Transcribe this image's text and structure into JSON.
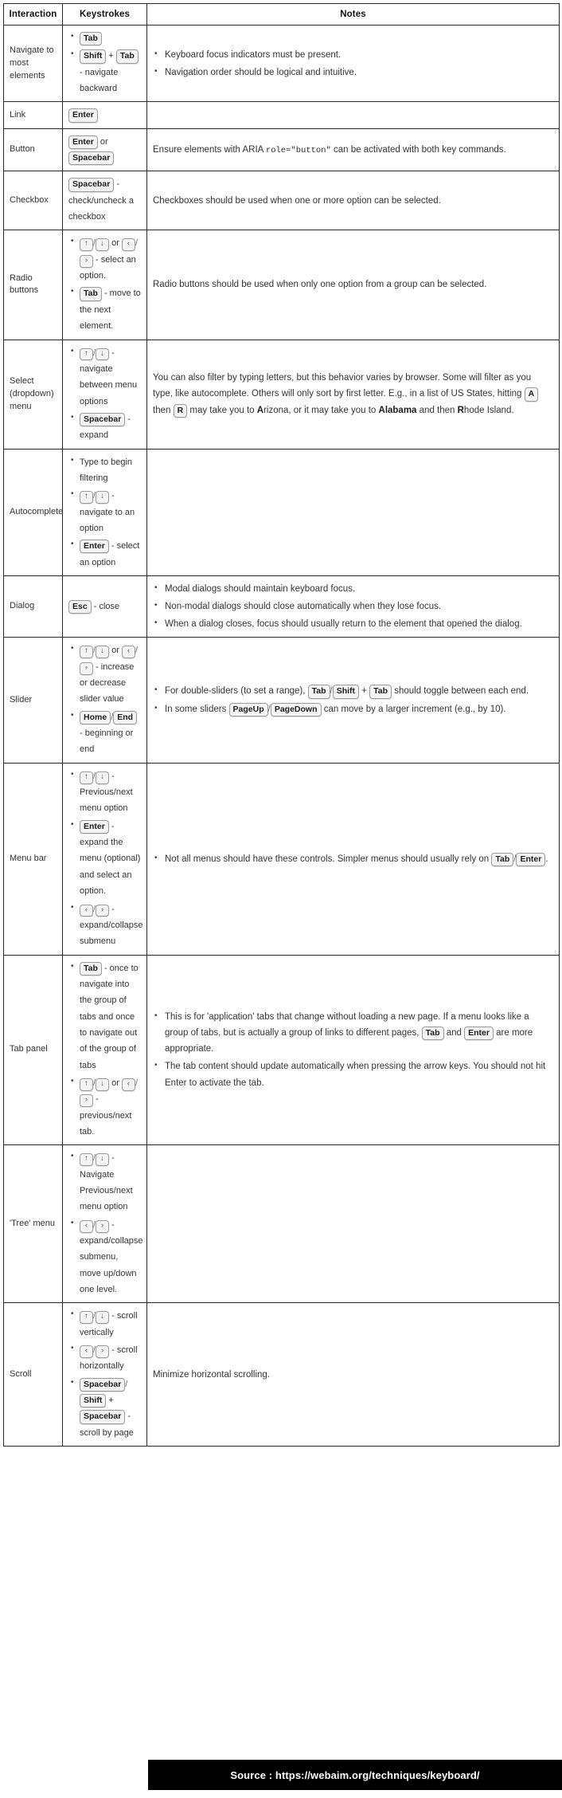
{
  "table": {
    "headers": [
      "Interaction",
      "Keystrokes",
      "Notes"
    ],
    "rows": [
      {
        "interaction": "Navigate to most elements",
        "keys": [
          {
            "parts": [
              {
                "t": "key",
                "v": "Tab"
              }
            ]
          },
          {
            "parts": [
              {
                "t": "key",
                "v": "Shift"
              },
              {
                "t": "text",
                "v": " + "
              },
              {
                "t": "key",
                "v": "Tab"
              },
              {
                "t": "text",
                "v": " - navigate backward"
              }
            ]
          }
        ],
        "notes": [
          {
            "parts": [
              {
                "t": "text",
                "v": "Keyboard focus indicators must be present."
              }
            ]
          },
          {
            "parts": [
              {
                "t": "text",
                "v": "Navigation order should be logical and intuitive."
              }
            ]
          }
        ]
      },
      {
        "interaction": "Link",
        "keys_plain": {
          "parts": [
            {
              "t": "key",
              "v": "Enter"
            }
          ]
        },
        "notes_plain": {
          "parts": []
        }
      },
      {
        "interaction": "Button",
        "keys_plain": {
          "parts": [
            {
              "t": "key",
              "v": "Enter"
            },
            {
              "t": "text",
              "v": " or "
            },
            {
              "t": "key",
              "v": "Spacebar"
            }
          ]
        },
        "notes_plain": {
          "parts": [
            {
              "t": "text",
              "v": "Ensure elements with ARIA "
            },
            {
              "t": "code",
              "v": "role=\"button\""
            },
            {
              "t": "text",
              "v": " can be activated with both key commands."
            }
          ]
        }
      },
      {
        "interaction": "Checkbox",
        "keys_plain": {
          "parts": [
            {
              "t": "key",
              "v": "Spacebar"
            },
            {
              "t": "text",
              "v": " - check/uncheck a checkbox"
            }
          ]
        },
        "notes_plain": {
          "parts": [
            {
              "t": "text",
              "v": "Checkboxes should be used when one or more option can be selected."
            }
          ]
        }
      },
      {
        "interaction": "Radio buttons",
        "keys": [
          {
            "parts": [
              {
                "t": "arrow",
                "v": "↑"
              },
              {
                "t": "slash"
              },
              {
                "t": "arrow",
                "v": "↓"
              },
              {
                "t": "text",
                "v": " or "
              },
              {
                "t": "arrow",
                "v": "‹"
              },
              {
                "t": "slash"
              },
              {
                "t": "arrow",
                "v": "›"
              },
              {
                "t": "text",
                "v": " - select an option."
              }
            ]
          },
          {
            "parts": [
              {
                "t": "key",
                "v": "Tab"
              },
              {
                "t": "text",
                "v": " - move to the next element."
              }
            ]
          }
        ],
        "notes_plain": {
          "parts": [
            {
              "t": "text",
              "v": "Radio buttons should be used when only one option from a group can be selected."
            }
          ]
        }
      },
      {
        "interaction": "Select (dropdown) menu",
        "keys": [
          {
            "parts": [
              {
                "t": "arrow",
                "v": "↑"
              },
              {
                "t": "slash"
              },
              {
                "t": "arrow",
                "v": "↓"
              },
              {
                "t": "text",
                "v": " - navigate between menu options"
              }
            ]
          },
          {
            "parts": [
              {
                "t": "key",
                "v": "Spacebar"
              },
              {
                "t": "text",
                "v": " - expand"
              }
            ]
          }
        ],
        "notes_plain": {
          "parts": [
            {
              "t": "text",
              "v": "You can also filter by typing letters, but this behavior varies by browser. Some will filter as you type, like autocomplete. Others will only sort by first letter. E.g., in a list of US States, hitting "
            },
            {
              "t": "key",
              "v": "A"
            },
            {
              "t": "text",
              "v": " then "
            },
            {
              "t": "key",
              "v": "R"
            },
            {
              "t": "text",
              "v": " may take you to "
            },
            {
              "t": "bold",
              "v": "A"
            },
            {
              "t": "text",
              "v": "rizona, or it may take you to "
            },
            {
              "t": "bold",
              "v": "Alabama"
            },
            {
              "t": "text",
              "v": " and then "
            },
            {
              "t": "bold",
              "v": "R"
            },
            {
              "t": "text",
              "v": "hode Island."
            }
          ]
        }
      },
      {
        "interaction": "Autocomplete",
        "keys": [
          {
            "parts": [
              {
                "t": "text",
                "v": "Type to begin filtering"
              }
            ]
          },
          {
            "parts": [
              {
                "t": "arrow",
                "v": "↑"
              },
              {
                "t": "slash"
              },
              {
                "t": "arrow",
                "v": "↓"
              },
              {
                "t": "text",
                "v": " - navigate to an option"
              }
            ]
          },
          {
            "parts": [
              {
                "t": "key",
                "v": "Enter"
              },
              {
                "t": "text",
                "v": " - select an option"
              }
            ]
          }
        ],
        "notes_plain": {
          "parts": []
        }
      },
      {
        "interaction": "Dialog",
        "keys_plain": {
          "parts": [
            {
              "t": "key",
              "v": "Esc"
            },
            {
              "t": "text",
              "v": " - close"
            }
          ]
        },
        "notes": [
          {
            "parts": [
              {
                "t": "text",
                "v": "Modal dialogs should maintain keyboard focus."
              }
            ]
          },
          {
            "parts": [
              {
                "t": "text",
                "v": "Non-modal dialogs should close automatically when they lose focus."
              }
            ]
          },
          {
            "parts": [
              {
                "t": "text",
                "v": "When a dialog closes, focus should usually return to the element that opened the dialog."
              }
            ]
          }
        ]
      },
      {
        "interaction": "Slider",
        "keys": [
          {
            "parts": [
              {
                "t": "arrow",
                "v": "↑"
              },
              {
                "t": "slash"
              },
              {
                "t": "arrow",
                "v": "↓"
              },
              {
                "t": "text",
                "v": " or "
              },
              {
                "t": "arrow",
                "v": "‹"
              },
              {
                "t": "slash"
              },
              {
                "t": "arrow",
                "v": "›"
              },
              {
                "t": "text",
                "v": " - increase or decrease slider value"
              }
            ]
          },
          {
            "parts": [
              {
                "t": "key",
                "v": "Home"
              },
              {
                "t": "slashtxt"
              },
              {
                "t": "key",
                "v": "End"
              },
              {
                "t": "text",
                "v": " - beginning or end"
              }
            ]
          }
        ],
        "notes": [
          {
            "parts": [
              {
                "t": "text",
                "v": "For double-sliders (to set a range), "
              },
              {
                "t": "key",
                "v": "Tab"
              },
              {
                "t": "slashtxt"
              },
              {
                "t": "key",
                "v": "Shift"
              },
              {
                "t": "text",
                "v": " + "
              },
              {
                "t": "key",
                "v": "Tab"
              },
              {
                "t": "text",
                "v": " should toggle between each end."
              }
            ]
          },
          {
            "parts": [
              {
                "t": "text",
                "v": "In some sliders "
              },
              {
                "t": "key",
                "v": "PageUp"
              },
              {
                "t": "slashtxt"
              },
              {
                "t": "key",
                "v": "PageDown"
              },
              {
                "t": "text",
                "v": " can move by a larger increment (e.g., by 10)."
              }
            ]
          }
        ]
      },
      {
        "interaction": "Menu bar",
        "keys": [
          {
            "parts": [
              {
                "t": "arrow",
                "v": "↑"
              },
              {
                "t": "slash"
              },
              {
                "t": "arrow",
                "v": "↓"
              },
              {
                "t": "text",
                "v": " - Previous/next menu option"
              }
            ]
          },
          {
            "parts": [
              {
                "t": "key",
                "v": "Enter"
              },
              {
                "t": "text",
                "v": " - expand the menu (optional) and select an option."
              }
            ]
          },
          {
            "parts": [
              {
                "t": "arrow",
                "v": "‹"
              },
              {
                "t": "slash"
              },
              {
                "t": "arrow",
                "v": "›"
              },
              {
                "t": "text",
                "v": " - expand/collapse submenu"
              }
            ]
          }
        ],
        "notes": [
          {
            "parts": [
              {
                "t": "text",
                "v": "Not all menus should have these controls. Simpler menus should usually rely on "
              },
              {
                "t": "key",
                "v": "Tab"
              },
              {
                "t": "slashtxt"
              },
              {
                "t": "key",
                "v": "Enter"
              },
              {
                "t": "text",
                "v": "."
              }
            ]
          }
        ]
      },
      {
        "interaction": "Tab panel",
        "keys": [
          {
            "parts": [
              {
                "t": "key",
                "v": "Tab"
              },
              {
                "t": "text",
                "v": " - once to navigate into the group of tabs and once to navigate out of the group of tabs"
              }
            ]
          },
          {
            "parts": [
              {
                "t": "arrow",
                "v": "↑"
              },
              {
                "t": "slash"
              },
              {
                "t": "arrow",
                "v": "↓"
              },
              {
                "t": "text",
                "v": " or "
              },
              {
                "t": "arrow",
                "v": "‹"
              },
              {
                "t": "slash"
              },
              {
                "t": "arrow",
                "v": "›"
              },
              {
                "t": "text",
                "v": " - previous/next tab."
              }
            ]
          }
        ],
        "notes": [
          {
            "parts": [
              {
                "t": "text",
                "v": "This is for 'application' tabs that change without loading a new page. If a menu looks like a group of tabs, but is actually a group of links to different pages, "
              },
              {
                "t": "key",
                "v": "Tab"
              },
              {
                "t": "text",
                "v": " and "
              },
              {
                "t": "key",
                "v": "Enter"
              },
              {
                "t": "text",
                "v": " are more appropriate."
              }
            ]
          },
          {
            "parts": [
              {
                "t": "text",
                "v": "The tab content should update automatically when pressing the arrow keys. You should not hit Enter to activate the tab."
              }
            ]
          }
        ]
      },
      {
        "interaction": "'Tree' menu",
        "keys": [
          {
            "parts": [
              {
                "t": "arrow",
                "v": "↑"
              },
              {
                "t": "slash"
              },
              {
                "t": "arrow",
                "v": "↓"
              },
              {
                "t": "text",
                "v": " - Navigate Previous/next menu option"
              }
            ]
          },
          {
            "parts": [
              {
                "t": "arrow",
                "v": "‹"
              },
              {
                "t": "slash"
              },
              {
                "t": "arrow",
                "v": "›"
              },
              {
                "t": "text",
                "v": " - expand/collapse submenu, move up/down one level."
              }
            ]
          }
        ],
        "notes_plain": {
          "parts": []
        }
      },
      {
        "interaction": "Scroll",
        "keys": [
          {
            "parts": [
              {
                "t": "arrow",
                "v": "↑"
              },
              {
                "t": "slash"
              },
              {
                "t": "arrow",
                "v": "↓"
              },
              {
                "t": "text",
                "v": " - scroll vertically"
              }
            ]
          },
          {
            "parts": [
              {
                "t": "arrow",
                "v": "‹"
              },
              {
                "t": "slash"
              },
              {
                "t": "arrow",
                "v": "›"
              },
              {
                "t": "text",
                "v": " - scroll horizontally"
              }
            ]
          },
          {
            "parts": [
              {
                "t": "key",
                "v": "Spacebar"
              },
              {
                "t": "slashtxt"
              },
              {
                "t": "key",
                "v": "Shift"
              },
              {
                "t": "text",
                "v": " + "
              },
              {
                "t": "key",
                "v": "Spacebar"
              },
              {
                "t": "text",
                "v": " - scroll by page"
              }
            ]
          }
        ],
        "notes_plain": {
          "parts": [
            {
              "t": "text",
              "v": "Minimize horizontal scrolling."
            }
          ]
        }
      }
    ]
  },
  "source": {
    "label": "Source : https://webaim.org/techniques/keyboard/"
  }
}
